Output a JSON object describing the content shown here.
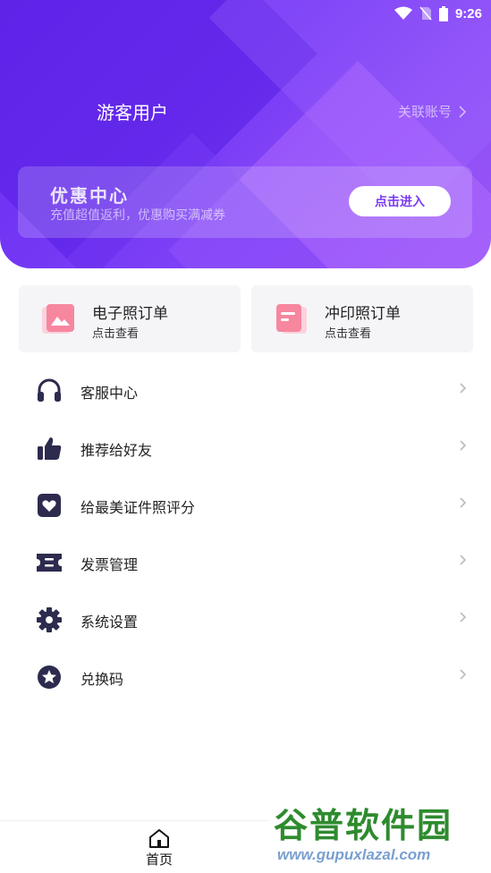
{
  "status_bar": {
    "time": "9:26"
  },
  "header": {
    "username": "游客用户",
    "link_account": "关联账号",
    "colors": {
      "gradient_start": "#6a2bf0",
      "gradient_end": "#9a57f6"
    }
  },
  "promo": {
    "title": "优惠中心",
    "subtitle": "充值超值返利，优惠购买满减券",
    "button_label": "点击进入"
  },
  "orders": [
    {
      "title": "电子照订单",
      "subtitle": "点击查看",
      "icon": "photo-icon"
    },
    {
      "title": "冲印照订单",
      "subtitle": "点击查看",
      "icon": "document-icon"
    }
  ],
  "menu": [
    {
      "label": "客服中心",
      "icon": "headphones-icon"
    },
    {
      "label": "推荐给好友",
      "icon": "thumbs-up-icon"
    },
    {
      "label": "给最美证件照评分",
      "icon": "heart-icon"
    },
    {
      "label": "发票管理",
      "icon": "ticket-icon"
    },
    {
      "label": "系统设置",
      "icon": "gear-icon"
    },
    {
      "label": "兑换码",
      "icon": "star-icon"
    }
  ],
  "bottom_nav": {
    "home_label": "首页"
  },
  "watermark": {
    "title": "谷普软件园",
    "url": "www.gupuxlazal.com"
  }
}
